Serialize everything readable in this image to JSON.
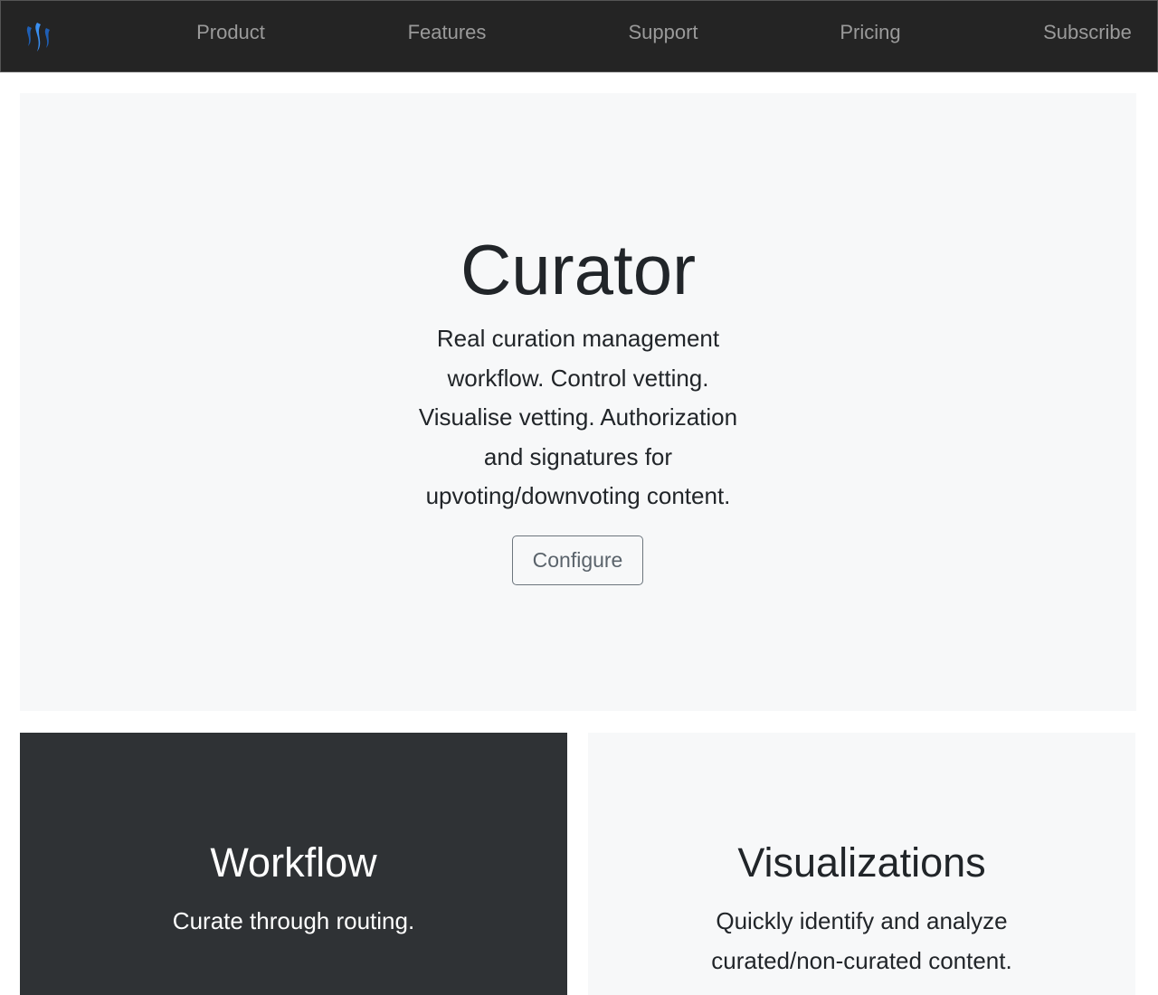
{
  "nav": {
    "items": [
      "Product",
      "Features",
      "Support",
      "Pricing",
      "Subscribe"
    ],
    "logo": "steem-logo-icon"
  },
  "hero": {
    "title": "Curator",
    "description": "Real curation management workflow. Control vetting. Visualise vetting. Authorization and signatures for upvoting/downvoting content.",
    "button": "Configure"
  },
  "cards": [
    {
      "title": "Workflow",
      "text": "Curate through routing."
    },
    {
      "title": "Visualizations",
      "text": "Quickly identify and analyze curated/non-curated content."
    }
  ],
  "colors": {
    "nav_bg": "#242424",
    "hero_bg": "#f7f8f9",
    "dark_card": "#2f3235",
    "logo_blue": "#2e7fe0"
  }
}
